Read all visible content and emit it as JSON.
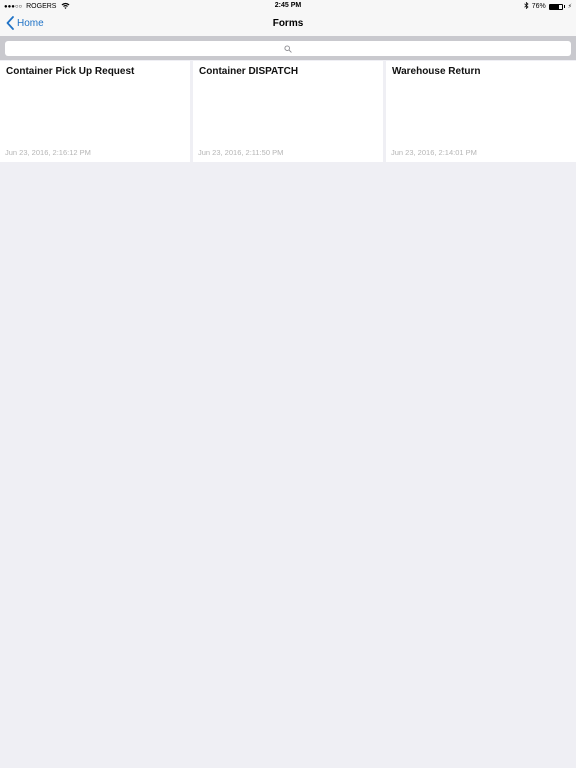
{
  "status_bar": {
    "signal": "●●●○○",
    "carrier": "ROGERS",
    "time": "2:45 PM",
    "battery_percent": "76%",
    "battery_level": 0.76
  },
  "nav": {
    "back_label": "Home",
    "title": "Forms"
  },
  "search": {
    "value": "",
    "placeholder": ""
  },
  "forms": [
    {
      "title": "Container Pick Up Request",
      "date": "Jun 23, 2016, 2:16:12 PM"
    },
    {
      "title": "Container DISPATCH",
      "date": "Jun 23, 2016, 2:11:50 PM"
    },
    {
      "title": "Warehouse Return",
      "date": "Jun 23, 2016, 2:14:01 PM"
    }
  ]
}
